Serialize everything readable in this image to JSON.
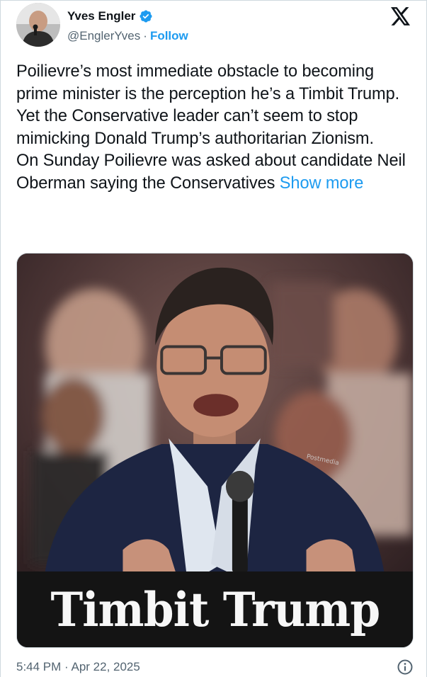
{
  "author": {
    "display_name": "Yves Engler",
    "handle": "@EnglerYves",
    "separator": "·",
    "follow_label": "Follow",
    "verified_icon": "verified-badge-icon"
  },
  "platform_icon": "x-logo-icon",
  "post": {
    "paragraph_1": "Poilievre’s most immediate obstacle to becoming prime minister is the perception he’s a Timbit Trump. Yet the Conservative leader can’t seem to stop mimicking Donald Trump’s authoritarian Zionism.",
    "paragraph_2": "On Sunday Poilievre was asked about candidate Neil Oberman saying the Conservatives",
    "show_more_label": "Show more"
  },
  "media": {
    "caption": "Timbit Trump",
    "watermark": "Postmedia"
  },
  "footer": {
    "timestamp": "5:44 PM · Apr 22, 2025",
    "info_icon": "info-icon"
  },
  "colors": {
    "accent": "#1d9bf0",
    "text_primary": "#0f1419",
    "text_secondary": "#536471",
    "border": "#cfd9de"
  }
}
